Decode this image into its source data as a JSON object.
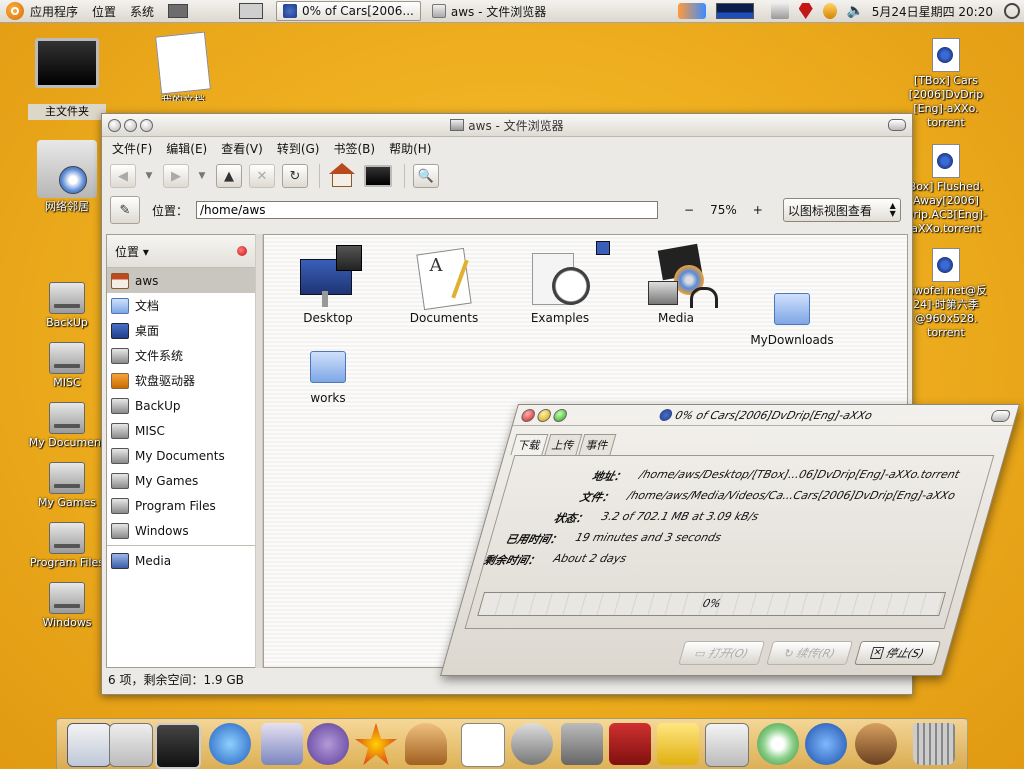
{
  "panel": {
    "menus": [
      "应用程序",
      "位置",
      "系统"
    ],
    "tasks": [
      {
        "label": "0% of Cars[2006..."
      },
      {
        "label": "aws - 文件浏览器"
      }
    ],
    "clock": "5月24日星期四  20:20"
  },
  "desktop": {
    "icons": [
      {
        "label": "主文件夹"
      },
      {
        "label": "我的文档"
      },
      {
        "label": "网络邻居"
      },
      {
        "label": "BackUp"
      },
      {
        "label": "MISC"
      },
      {
        "label": "My Document"
      },
      {
        "label": "My Games"
      },
      {
        "label": "Program Files"
      },
      {
        "label": "Windows"
      },
      {
        "label": "[TBox] Cars [2006]DvDrip [Eng]-aXXo. torrent"
      },
      {
        "label": "Box] Flushed. Away[2006] Drip.AC3[Eng]- aXXo.torrent"
      },
      {
        "label": "s.wofei.net@反 24]·时第六季 @960x528. torrent"
      }
    ]
  },
  "file_manager": {
    "title": "aws - 文件浏览器",
    "menu": [
      "文件(F)",
      "编辑(E)",
      "查看(V)",
      "转到(G)",
      "书签(B)",
      "帮助(H)"
    ],
    "location_label": "位置：",
    "location_value": "/home/aws",
    "zoom_minus": "−",
    "zoom_level": "75%",
    "zoom_plus": "+",
    "view_mode": "以图标视图查看",
    "sidebar_title": "位置",
    "sidebar_items": [
      {
        "label": "aws"
      },
      {
        "label": "文档"
      },
      {
        "label": "桌面"
      },
      {
        "label": "文件系统"
      },
      {
        "label": "软盘驱动器"
      },
      {
        "label": "BackUp"
      },
      {
        "label": "MISC"
      },
      {
        "label": "My Documents"
      },
      {
        "label": "My Games"
      },
      {
        "label": "Program Files"
      },
      {
        "label": "Windows"
      },
      {
        "label": "Media"
      }
    ],
    "files": [
      {
        "label": "Desktop"
      },
      {
        "label": "Documents"
      },
      {
        "label": "Examples"
      },
      {
        "label": "Media"
      },
      {
        "label": "MyDownloads"
      },
      {
        "label": "works"
      }
    ],
    "status": "6 项，剩余空间：1.9 GB"
  },
  "torrent": {
    "title": "0% of Cars[2006]DvDrip[Eng]-aXXo",
    "tabs": [
      "下载",
      "上传",
      "事件"
    ],
    "rows": [
      {
        "key": "地址：",
        "value": "/home/aws/Desktop/[TBox]...06]DvDrip[Eng]-aXXo.torrent"
      },
      {
        "key": "文件：",
        "value": "/home/aws/Media/Videos/Ca...Cars[2006]DvDrip[Eng]-aXXo"
      },
      {
        "key": "状态：",
        "value": "3.2 of 702.1 MB at 3.09 kB/s"
      },
      {
        "key": "已用时间：",
        "value": "19 minutes and 3 seconds"
      },
      {
        "key": "剩余时间：",
        "value": "About 2 days"
      }
    ],
    "progress_text": "0%",
    "progress_value": 0,
    "buttons": {
      "open": "打开(O)",
      "resume": "续传(R)",
      "stop": "停止(S)"
    }
  }
}
